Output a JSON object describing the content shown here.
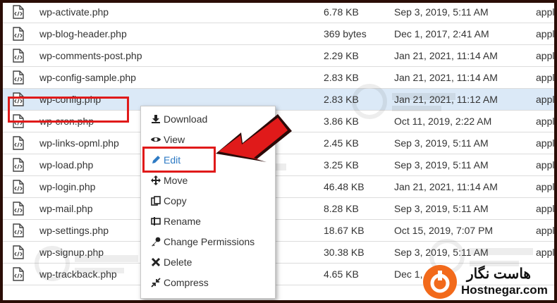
{
  "files": [
    {
      "name": "wp-activate.php",
      "size": "6.78 KB",
      "date": "Sep 3, 2019, 5:11 AM",
      "type": "applic"
    },
    {
      "name": "wp-blog-header.php",
      "size": "369 bytes",
      "date": "Dec 1, 2017, 2:41 AM",
      "type": "applic"
    },
    {
      "name": "wp-comments-post.php",
      "size": "2.29 KB",
      "date": "Jan 21, 2021, 11:14 AM",
      "type": "applic"
    },
    {
      "name": "wp-config-sample.php",
      "size": "2.83 KB",
      "date": "Jan 21, 2021, 11:14 AM",
      "type": "applic"
    },
    {
      "name": "wp-config.php",
      "size": "2.83 KB",
      "date": "Jan 21, 2021, 11:12 AM",
      "type": "applic",
      "selected": true
    },
    {
      "name": "wp-cron.php",
      "size": "3.86 KB",
      "date": "Oct 11, 2019, 2:22 AM",
      "type": "applic"
    },
    {
      "name": "wp-links-opml.php",
      "size": "2.45 KB",
      "date": "Sep 3, 2019, 5:11 AM",
      "type": "applic"
    },
    {
      "name": "wp-load.php",
      "size": "3.25 KB",
      "date": "Sep 3, 2019, 5:11 AM",
      "type": "applic"
    },
    {
      "name": "wp-login.php",
      "size": "46.48 KB",
      "date": "Jan 21, 2021, 11:14 AM",
      "type": "applic"
    },
    {
      "name": "wp-mail.php",
      "size": "8.28 KB",
      "date": "Sep 3, 2019, 5:11 AM",
      "type": "applic"
    },
    {
      "name": "wp-settings.php",
      "size": "18.67 KB",
      "date": "Oct 15, 2019, 7:07 PM",
      "type": "applic"
    },
    {
      "name": "wp-signup.php",
      "size": "30.38 KB",
      "date": "Sep 3, 2019, 5:11 AM",
      "type": "applic"
    },
    {
      "name": "wp-trackback.php",
      "size": "4.65 KB",
      "date": "Dec 1,",
      "type": ""
    }
  ],
  "context_menu": {
    "download": "Download",
    "view": "View",
    "edit": "Edit",
    "move": "Move",
    "copy": "Copy",
    "rename": "Rename",
    "permissions": "Change Permissions",
    "delete": "Delete",
    "compress": "Compress"
  },
  "icons": {
    "file": "php-file-icon",
    "download": "download-icon",
    "view": "eye-icon",
    "edit": "pencil-icon",
    "move": "move-arrows-icon",
    "copy": "copy-icon",
    "rename": "rename-icon",
    "permissions": "key-icon",
    "delete": "x-icon",
    "compress": "compress-icon"
  },
  "colors": {
    "selected_row": "#dbe9f7",
    "highlight_red": "#e01a1a",
    "link_blue": "#2e7bc4",
    "brand_orange": "#f26a1b",
    "frame": "#2a0d06"
  },
  "logo": {
    "persian": "هاست نگار",
    "english": "Hostnegar.com"
  }
}
